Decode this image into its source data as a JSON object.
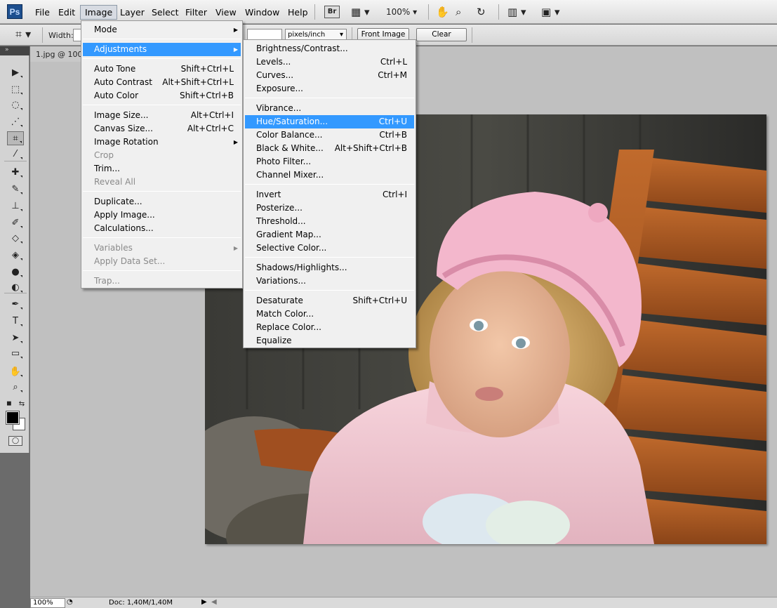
{
  "app": {
    "logo": "Ps"
  },
  "menubar": {
    "items": [
      "File",
      "Edit",
      "Image",
      "Layer",
      "Select",
      "Filter",
      "View",
      "Window",
      "Help"
    ],
    "bridge": "Br",
    "zoom": "100%"
  },
  "options": {
    "width_label": "Width:",
    "resolution_unit": "pixels/inch",
    "front_image": "Front Image",
    "clear": "Clear"
  },
  "document": {
    "tab_title": "1.jpg @ 100"
  },
  "status": {
    "zoom": "100%",
    "doc_info": "Doc: 1,40M/1,40M"
  },
  "image_menu": [
    {
      "type": "item",
      "label": "Mode",
      "submenu": true
    },
    {
      "type": "sep"
    },
    {
      "type": "item",
      "label": "Adjustments",
      "submenu": true,
      "highlighted": true
    },
    {
      "type": "sep"
    },
    {
      "type": "item",
      "label": "Auto Tone",
      "shortcut": "Shift+Ctrl+L"
    },
    {
      "type": "item",
      "label": "Auto Contrast",
      "shortcut": "Alt+Shift+Ctrl+L"
    },
    {
      "type": "item",
      "label": "Auto Color",
      "shortcut": "Shift+Ctrl+B"
    },
    {
      "type": "sep"
    },
    {
      "type": "item",
      "label": "Image Size...",
      "shortcut": "Alt+Ctrl+I"
    },
    {
      "type": "item",
      "label": "Canvas Size...",
      "shortcut": "Alt+Ctrl+C"
    },
    {
      "type": "item",
      "label": "Image Rotation",
      "submenu": true
    },
    {
      "type": "item",
      "label": "Crop",
      "disabled": true
    },
    {
      "type": "item",
      "label": "Trim..."
    },
    {
      "type": "item",
      "label": "Reveal All",
      "disabled": true
    },
    {
      "type": "sep"
    },
    {
      "type": "item",
      "label": "Duplicate..."
    },
    {
      "type": "item",
      "label": "Apply Image..."
    },
    {
      "type": "item",
      "label": "Calculations..."
    },
    {
      "type": "sep"
    },
    {
      "type": "item",
      "label": "Variables",
      "submenu": true,
      "disabled": true
    },
    {
      "type": "item",
      "label": "Apply Data Set...",
      "disabled": true
    },
    {
      "type": "sep"
    },
    {
      "type": "item",
      "label": "Trap...",
      "disabled": true
    }
  ],
  "adjustments_menu": [
    {
      "type": "item",
      "label": "Brightness/Contrast..."
    },
    {
      "type": "item",
      "label": "Levels...",
      "shortcut": "Ctrl+L"
    },
    {
      "type": "item",
      "label": "Curves...",
      "shortcut": "Ctrl+M"
    },
    {
      "type": "item",
      "label": "Exposure..."
    },
    {
      "type": "sep"
    },
    {
      "type": "item",
      "label": "Vibrance..."
    },
    {
      "type": "item",
      "label": "Hue/Saturation...",
      "shortcut": "Ctrl+U",
      "highlighted": true
    },
    {
      "type": "item",
      "label": "Color Balance...",
      "shortcut": "Ctrl+B"
    },
    {
      "type": "item",
      "label": "Black & White...",
      "shortcut": "Alt+Shift+Ctrl+B"
    },
    {
      "type": "item",
      "label": "Photo Filter..."
    },
    {
      "type": "item",
      "label": "Channel Mixer..."
    },
    {
      "type": "sep"
    },
    {
      "type": "item",
      "label": "Invert",
      "shortcut": "Ctrl+I"
    },
    {
      "type": "item",
      "label": "Posterize..."
    },
    {
      "type": "item",
      "label": "Threshold..."
    },
    {
      "type": "item",
      "label": "Gradient Map..."
    },
    {
      "type": "item",
      "label": "Selective Color..."
    },
    {
      "type": "sep"
    },
    {
      "type": "item",
      "label": "Shadows/Highlights..."
    },
    {
      "type": "item",
      "label": "Variations..."
    },
    {
      "type": "sep"
    },
    {
      "type": "item",
      "label": "Desaturate",
      "shortcut": "Shift+Ctrl+U"
    },
    {
      "type": "item",
      "label": "Match Color..."
    },
    {
      "type": "item",
      "label": "Replace Color..."
    },
    {
      "type": "item",
      "label": "Equalize"
    }
  ],
  "tools": [
    {
      "icon": "move-tool-icon",
      "glyph": "▶"
    },
    {
      "icon": "marquee-tool-icon",
      "glyph": "⬚"
    },
    {
      "icon": "lasso-tool-icon",
      "glyph": "◌"
    },
    {
      "icon": "magic-wand-tool-icon",
      "glyph": "⋰"
    },
    {
      "icon": "crop-tool-icon",
      "glyph": "⌗",
      "active": true
    },
    {
      "icon": "eyedropper-tool-icon",
      "glyph": "⁄"
    },
    {
      "icon": "healing-brush-tool-icon",
      "glyph": "✚"
    },
    {
      "icon": "brush-tool-icon",
      "glyph": "✎"
    },
    {
      "icon": "clone-stamp-tool-icon",
      "glyph": "⊥"
    },
    {
      "icon": "history-brush-tool-icon",
      "glyph": "✐"
    },
    {
      "icon": "eraser-tool-icon",
      "glyph": "◇"
    },
    {
      "icon": "paint-bucket-tool-icon",
      "glyph": "◈"
    },
    {
      "icon": "blur-tool-icon",
      "glyph": "●"
    },
    {
      "icon": "dodge-tool-icon",
      "glyph": "◐"
    },
    {
      "icon": "pen-tool-icon",
      "glyph": "✒"
    },
    {
      "icon": "type-tool-icon",
      "glyph": "T"
    },
    {
      "icon": "path-selection-tool-icon",
      "glyph": "➤"
    },
    {
      "icon": "shape-tool-icon",
      "glyph": "▭"
    },
    {
      "icon": "hand-tool-icon",
      "glyph": "✋"
    },
    {
      "icon": "zoom-tool-icon",
      "glyph": "⌕"
    }
  ],
  "colors": {
    "highlight": "#3399ff",
    "menu_bg": "#f0f0f0",
    "canvas_bg": "#c0c0c0"
  }
}
